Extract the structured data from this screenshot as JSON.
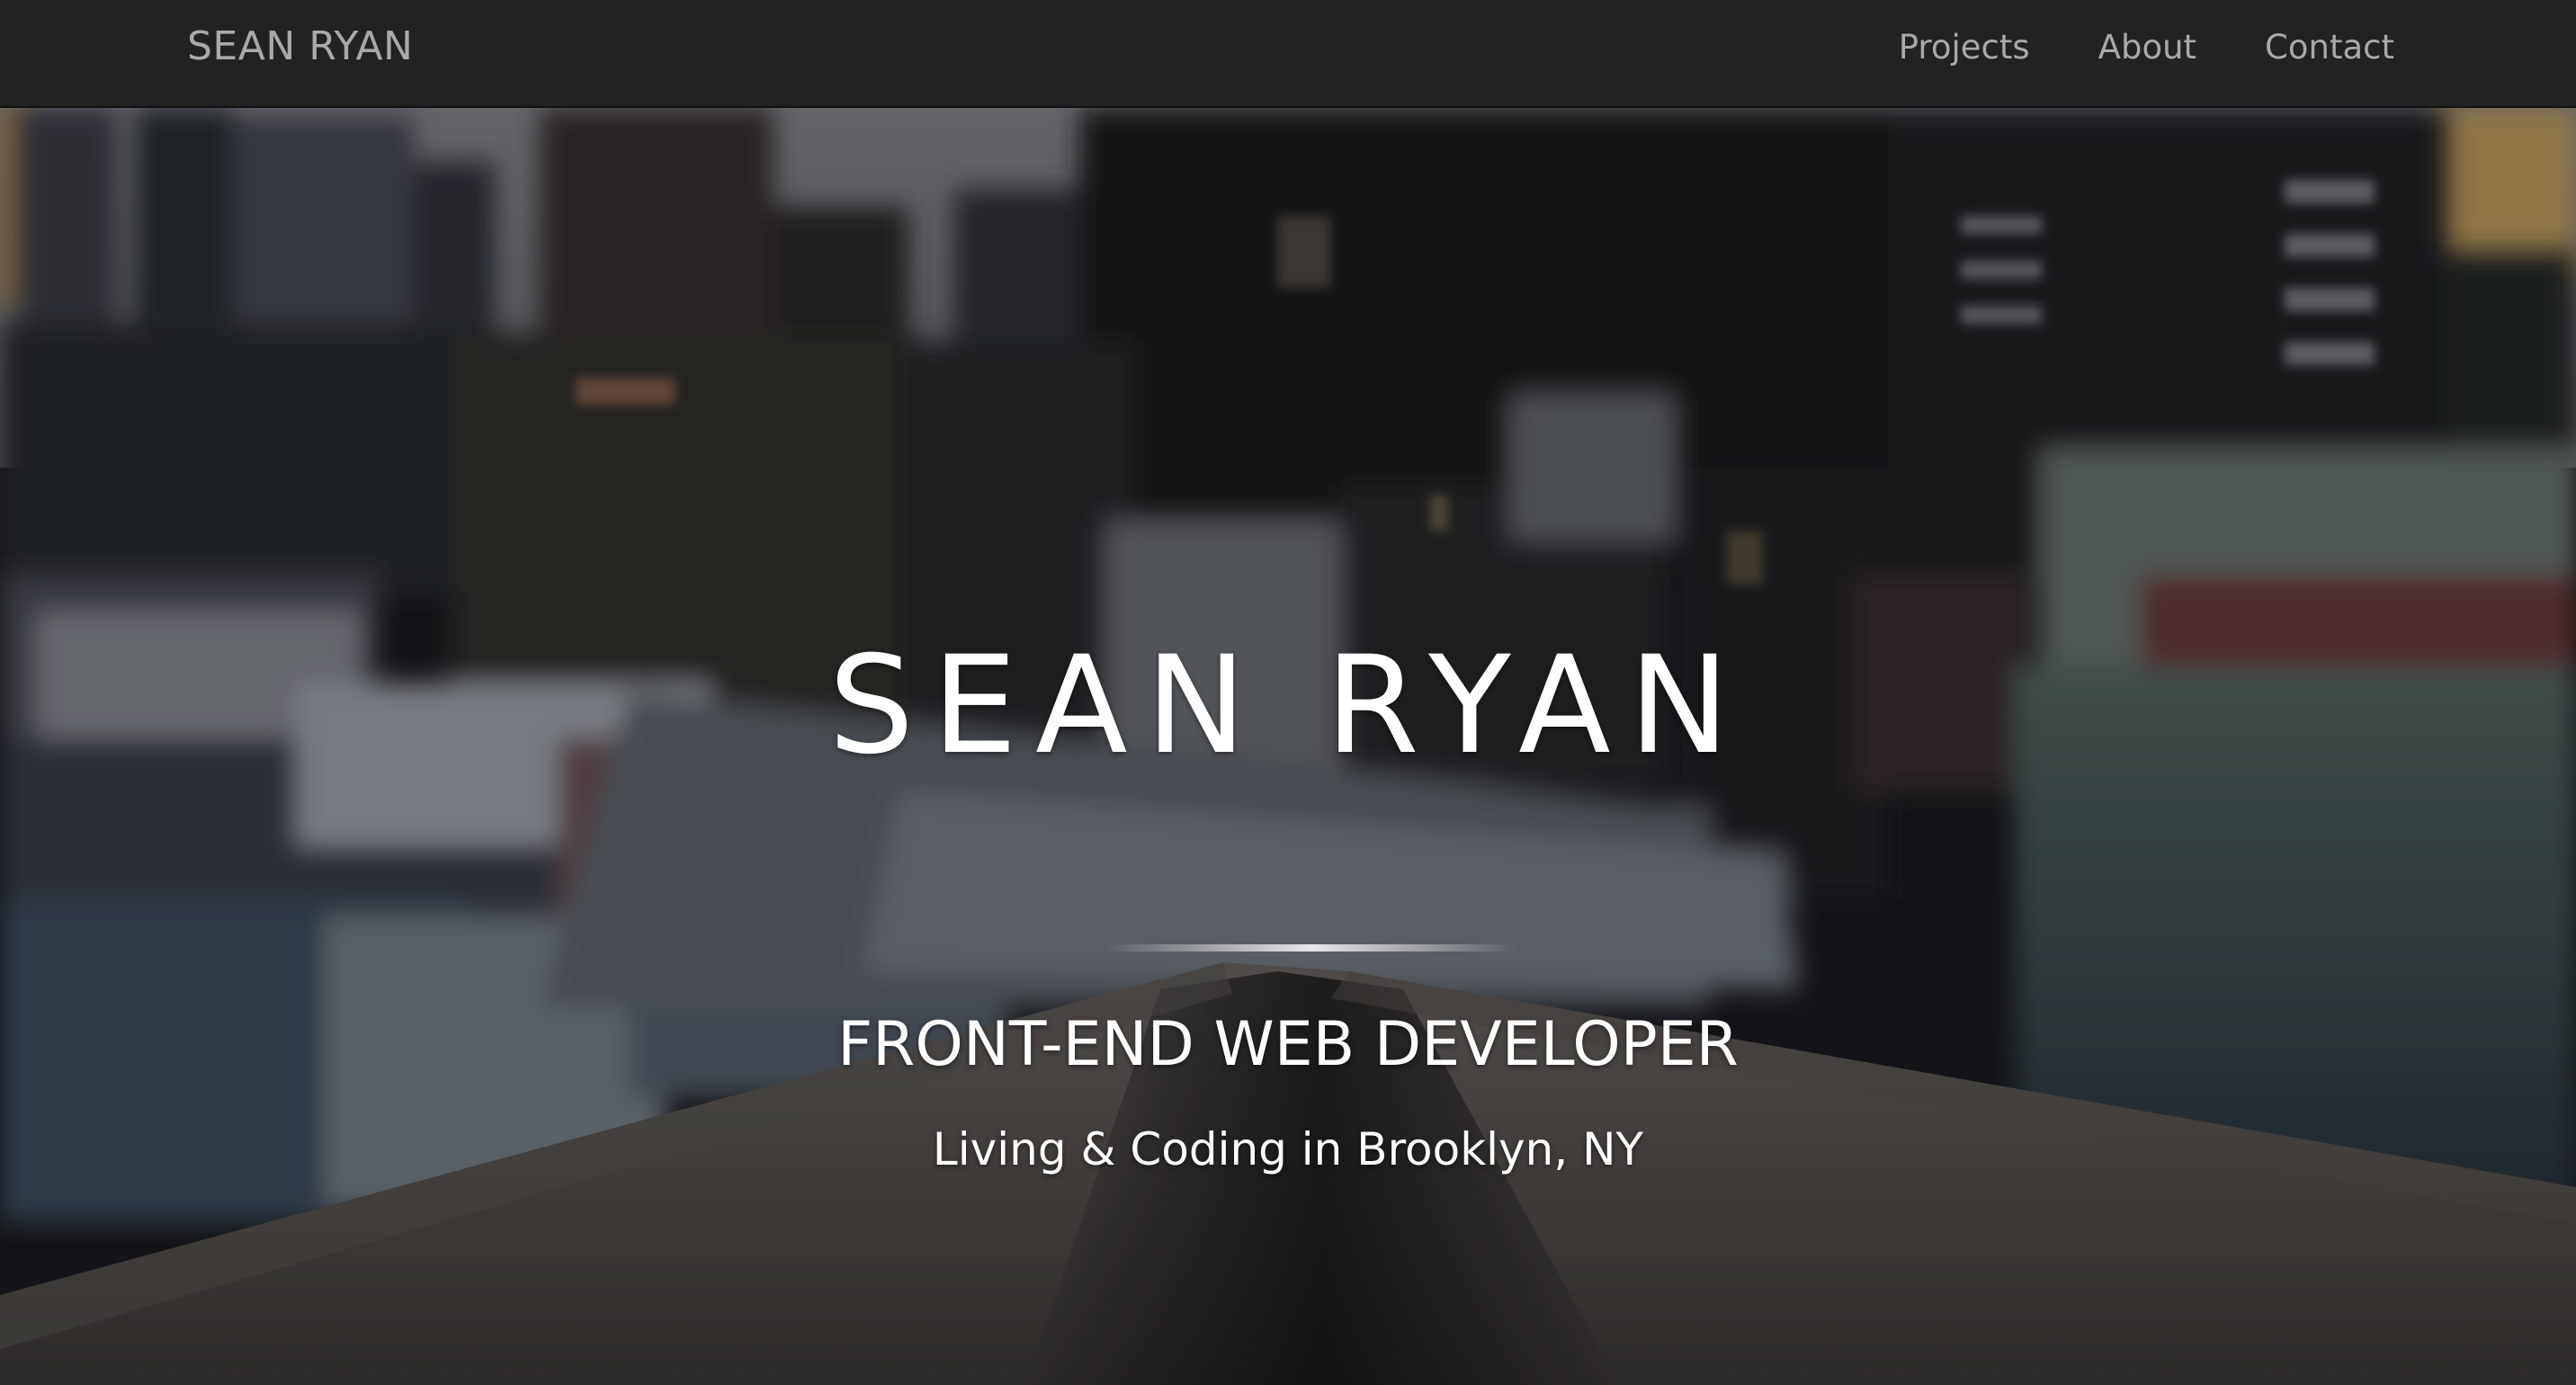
{
  "navbar": {
    "brand": "SEAN RYAN",
    "links": [
      {
        "label": "Projects"
      },
      {
        "label": "About"
      },
      {
        "label": "Contact"
      }
    ]
  },
  "hero": {
    "title": "SEAN RYAN",
    "subtitle": "FRONT-END WEB DEVELOPER",
    "tagline": "Living & Coding in Brooklyn, NY"
  },
  "colors": {
    "navbar_bg": "#222222",
    "nav_text": "#a9a9a9",
    "hero_text": "#ffffff"
  }
}
